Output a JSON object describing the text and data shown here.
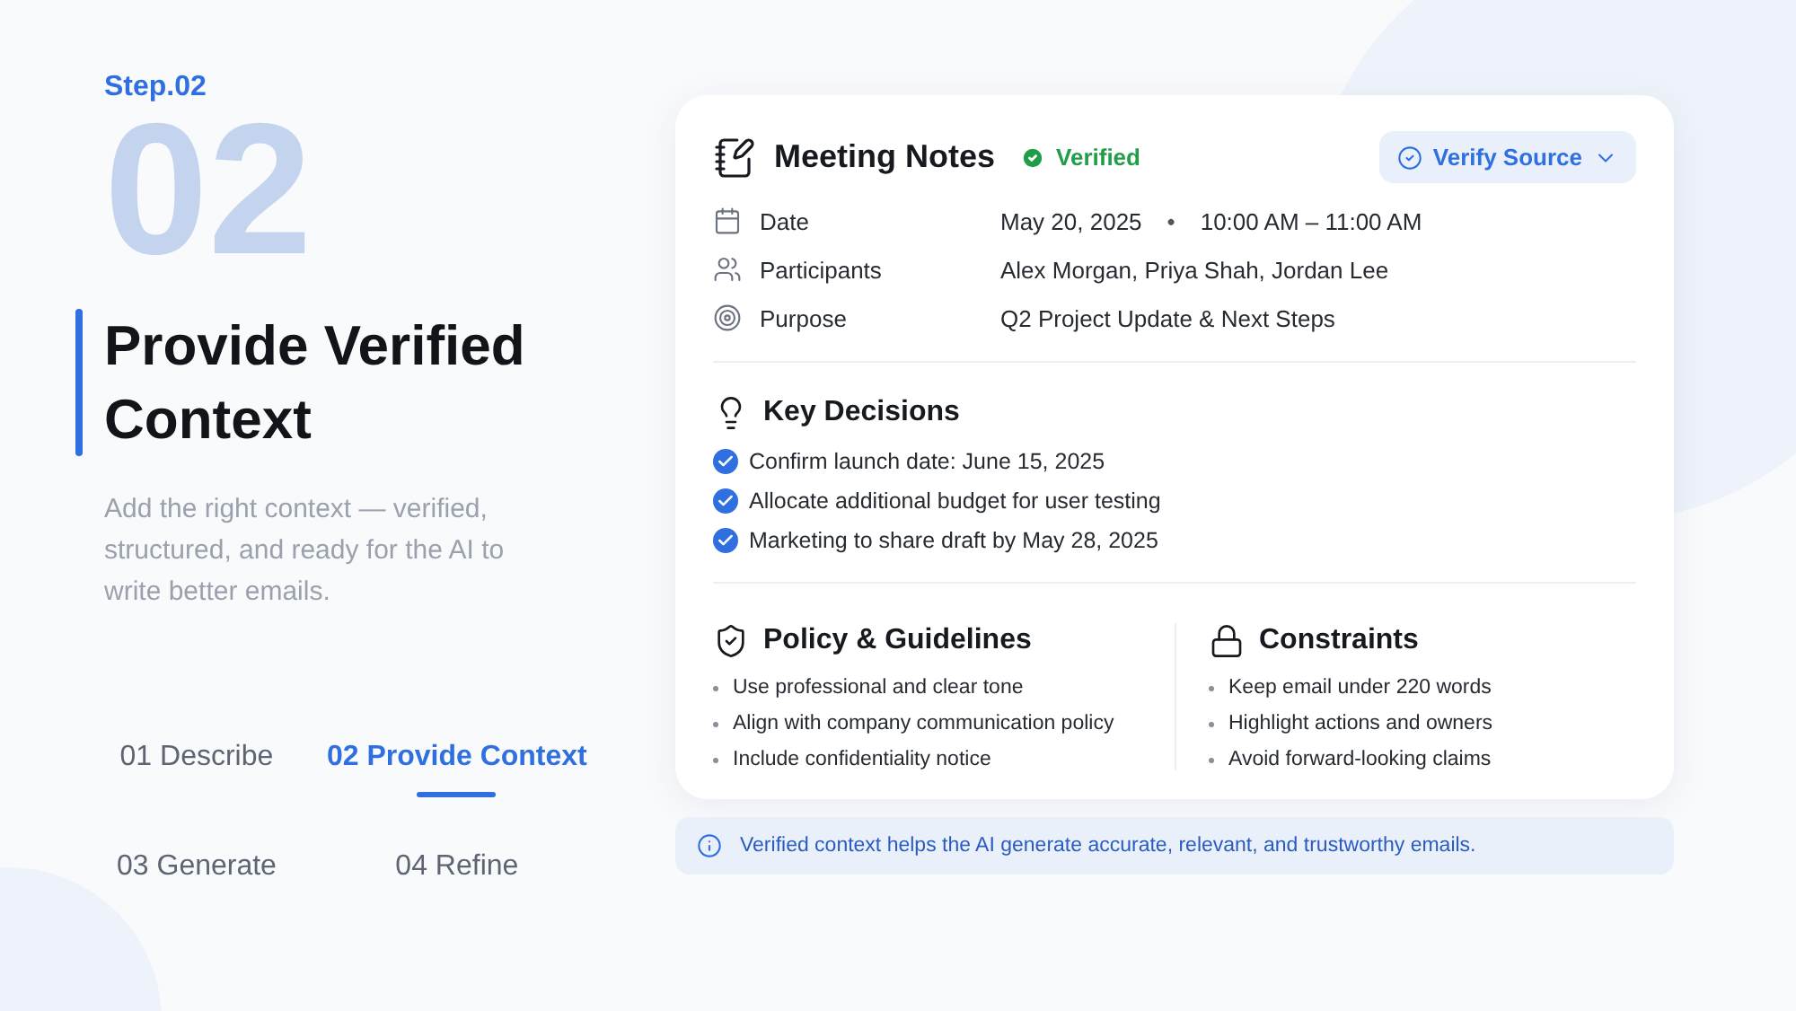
{
  "step_label": "Step.02",
  "big_number": "02",
  "title": "Provide Verified Context",
  "description": "Add the right context — verified, structured, and ready for the AI to write better emails.",
  "steps": [
    {
      "label": "01 Describe",
      "selected": false
    },
    {
      "label": "02 Provide Context",
      "selected": true
    },
    {
      "label": "03 Generate",
      "selected": false
    },
    {
      "label": "04 Refine",
      "selected": false
    }
  ],
  "card": {
    "title": "Meeting Notes",
    "badge": "Verified",
    "verify_button": "Verify Source",
    "details": [
      {
        "kind": "date",
        "label": "Date",
        "value": "May 20, 2025",
        "separator": "•",
        "time": "10:00 AM – 11:00 AM"
      },
      {
        "kind": "people",
        "label": "Participants",
        "value": "Alex Morgan, Priya Shah, Jordan Lee"
      },
      {
        "kind": "target",
        "label": "Purpose",
        "value": "Q2 Project Update & Next Steps"
      }
    ],
    "decisions": {
      "title": "Key Decisions",
      "items": [
        {
          "text": "Confirm launch date: June 15, 2025",
          "checked": true
        },
        {
          "text": "Allocate additional budget for user testing",
          "checked": true
        },
        {
          "text": "Marketing to share draft by May 28, 2025",
          "checked": true
        }
      ]
    },
    "sections": [
      {
        "kind": "shield",
        "title": "Policy & Guidelines",
        "items": [
          "Use professional and clear tone",
          "Align with company communication policy",
          "Include confidentiality notice"
        ]
      },
      {
        "kind": "lock",
        "title": "Constraints",
        "items": [
          "Keep email under 220 words",
          "Highlight actions and owners",
          "Avoid forward-looking claims"
        ]
      }
    ]
  },
  "info_note": "Verified context helps the AI generate accurate, relevant, and trustworthy emails."
}
